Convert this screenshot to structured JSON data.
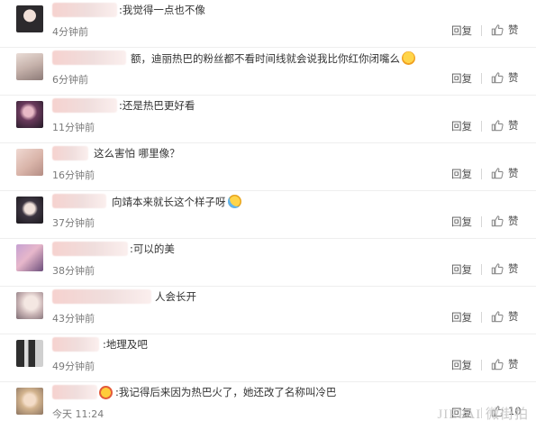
{
  "comments": [
    {
      "text": ":我觉得一点也不像",
      "time": "4分钟前",
      "reply": "回复",
      "like": "赞"
    },
    {
      "text": "额，迪丽热巴的粉丝都不看时间线就会说我比你红你闭嘴么",
      "time": "6分钟前",
      "reply": "回复",
      "like": "赞",
      "emoji": "hug-emoji"
    },
    {
      "text": ":还是热巴更好看",
      "time": "11分钟前",
      "reply": "回复",
      "like": "赞"
    },
    {
      "text": "这么害怕   哪里像？",
      "time": "16分钟前",
      "reply": "回复",
      "like": "赞"
    },
    {
      "text": "向靖本来就长这个样子呀",
      "time": "37分钟前",
      "reply": "回复",
      "like": "赞",
      "emoji": "sweat-smile-emoji"
    },
    {
      "text": ":可以的美",
      "time": "38分钟前",
      "reply": "回复",
      "like": "赞"
    },
    {
      "text": "人会长开",
      "time": "43分钟前",
      "reply": "回复",
      "like": "赞"
    },
    {
      "text": ":地理及吧",
      "time": "49分钟前",
      "reply": "回复",
      "like": "赞"
    },
    {
      "text": ":我记得后来因为热巴火了，她还改了名称叫冷巴",
      "time": "今天 11:24",
      "reply": "回复",
      "like": "10"
    }
  ],
  "watermark": "JIEPAI 微街拍",
  "colors": {
    "like_icon": "#8a8a8a",
    "text": "#333333",
    "meta": "#7a7a7a"
  }
}
